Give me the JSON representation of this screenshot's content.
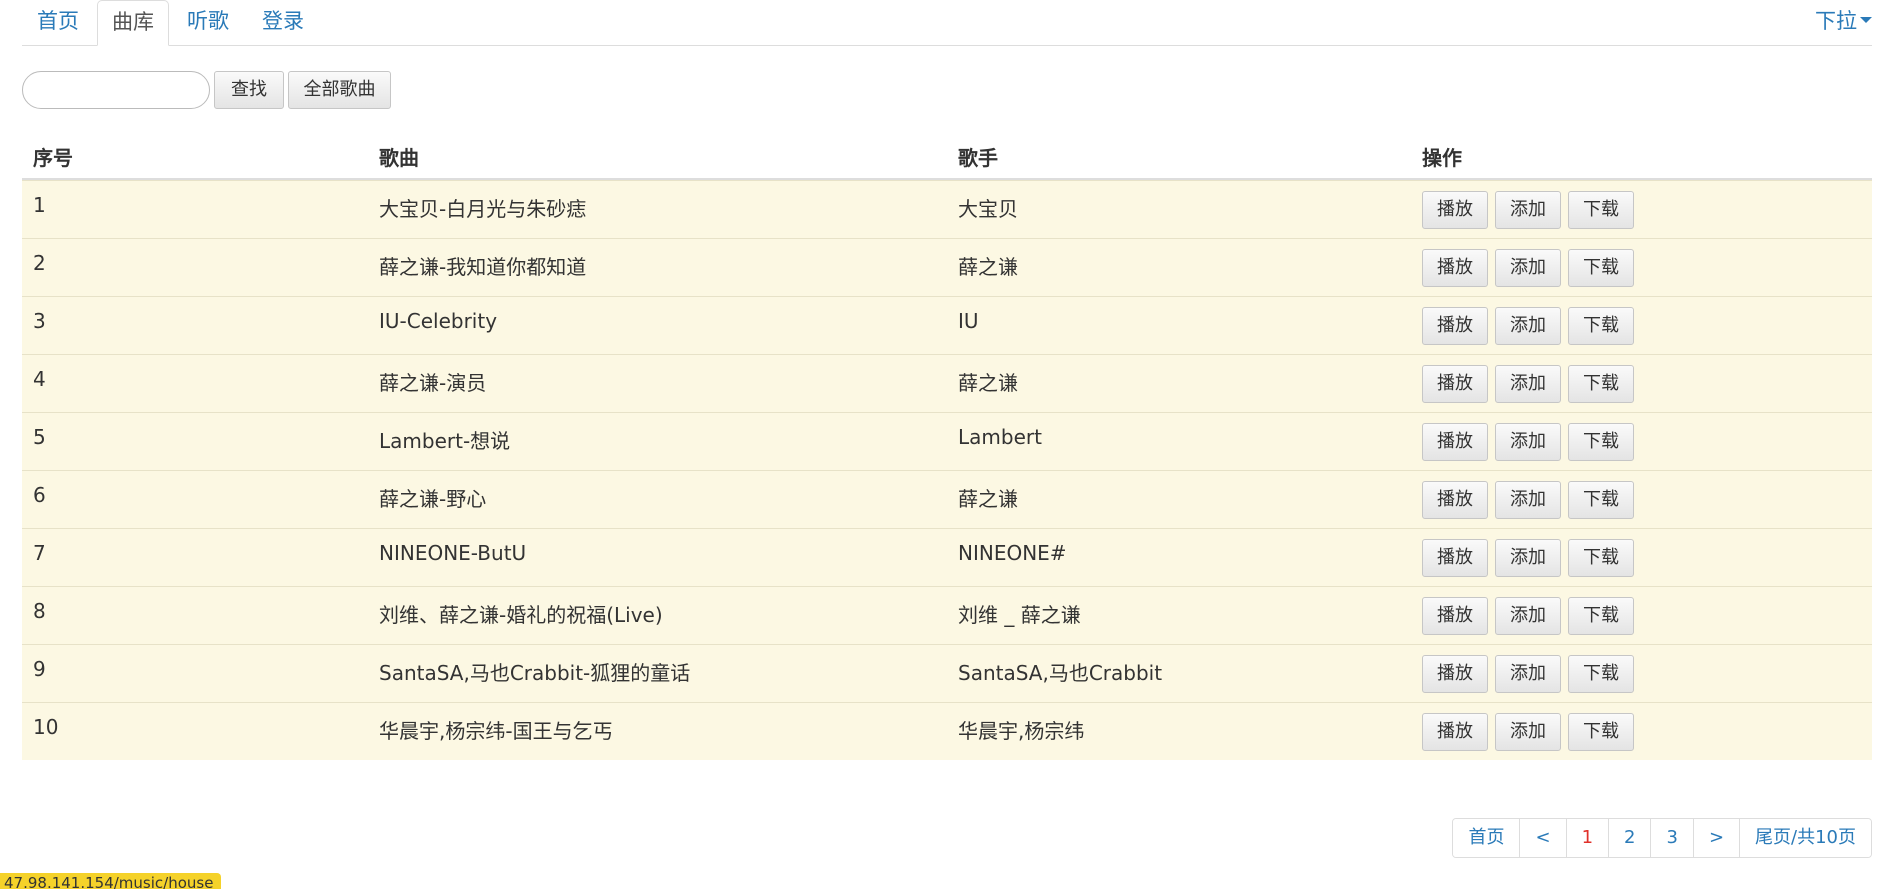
{
  "nav": {
    "tabs": [
      {
        "label": "首页"
      },
      {
        "label": "曲库"
      },
      {
        "label": "听歌"
      },
      {
        "label": "登录"
      }
    ],
    "active_tab": "曲库",
    "dropdown_label": "下拉"
  },
  "search": {
    "value": "",
    "placeholder": "",
    "find_label": "查找",
    "all_songs_label": "全部歌曲"
  },
  "table": {
    "headers": [
      "序号",
      "歌曲",
      "歌手",
      "操作"
    ],
    "actions": [
      "播放",
      "添加",
      "下载"
    ],
    "rows": [
      {
        "num": "1",
        "song": "大宝贝-白月光与朱砂痣",
        "artist": "大宝贝"
      },
      {
        "num": "2",
        "song": "薛之谦-我知道你都知道",
        "artist": "薛之谦"
      },
      {
        "num": "3",
        "song": "IU-Celebrity",
        "artist": "IU"
      },
      {
        "num": "4",
        "song": "薛之谦-演员",
        "artist": "薛之谦"
      },
      {
        "num": "5",
        "song": "Lambert-想说",
        "artist": "Lambert"
      },
      {
        "num": "6",
        "song": "薛之谦-野心",
        "artist": "薛之谦"
      },
      {
        "num": "7",
        "song": "NINEONE-ButU",
        "artist": "NINEONE#"
      },
      {
        "num": "8",
        "song": "刘维、薛之谦-婚礼的祝福(Live)",
        "artist": "刘维 _ 薛之谦"
      },
      {
        "num": "9",
        "song": "SantaSA,马也Crabbit-狐狸的童话",
        "artist": "SantaSA,马也Crabbit"
      },
      {
        "num": "10",
        "song": "华晨宇,杨宗纬-国王与乞丐",
        "artist": "华晨宇,杨宗纬"
      }
    ]
  },
  "pagination": {
    "first": "首页",
    "prev": "<",
    "pages": [
      "1",
      "2",
      "3"
    ],
    "current": "1",
    "next": ">",
    "last": "尾页/共10页"
  },
  "status_url": "47.98.141.154/music/house",
  "colors": {
    "link": "#2a7ab8",
    "row_bg": "#fcf8e3",
    "current_page": "#e0312a",
    "status_bg": "#f5d22a"
  }
}
